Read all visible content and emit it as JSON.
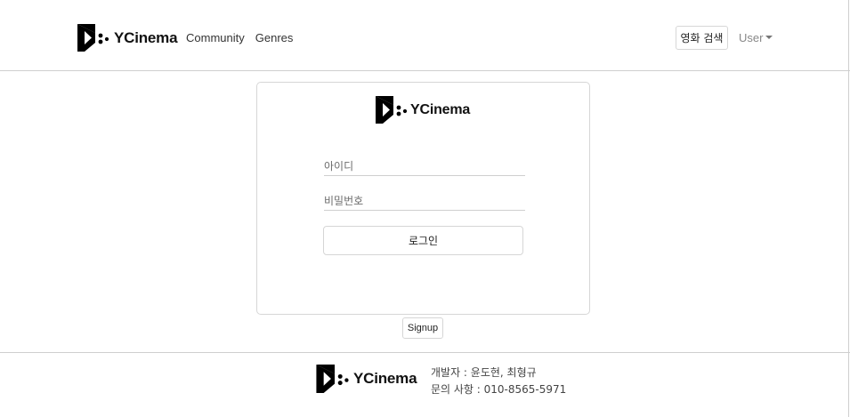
{
  "header": {
    "brand_name": "YCinema",
    "nav": [
      "Community",
      "Genres"
    ],
    "search_button_label": "영화 검색",
    "user_menu_label": "User"
  },
  "login": {
    "brand_name": "YCinema",
    "id_placeholder": "아이디",
    "password_placeholder": "비밀번호",
    "login_button_label": "로그인"
  },
  "signup_button_label": "Signup",
  "footer": {
    "brand_name": "YCinema",
    "developers": "개발자 : 윤도현, 최형규",
    "contact": "문의 사항 : 010-8565-5971"
  }
}
